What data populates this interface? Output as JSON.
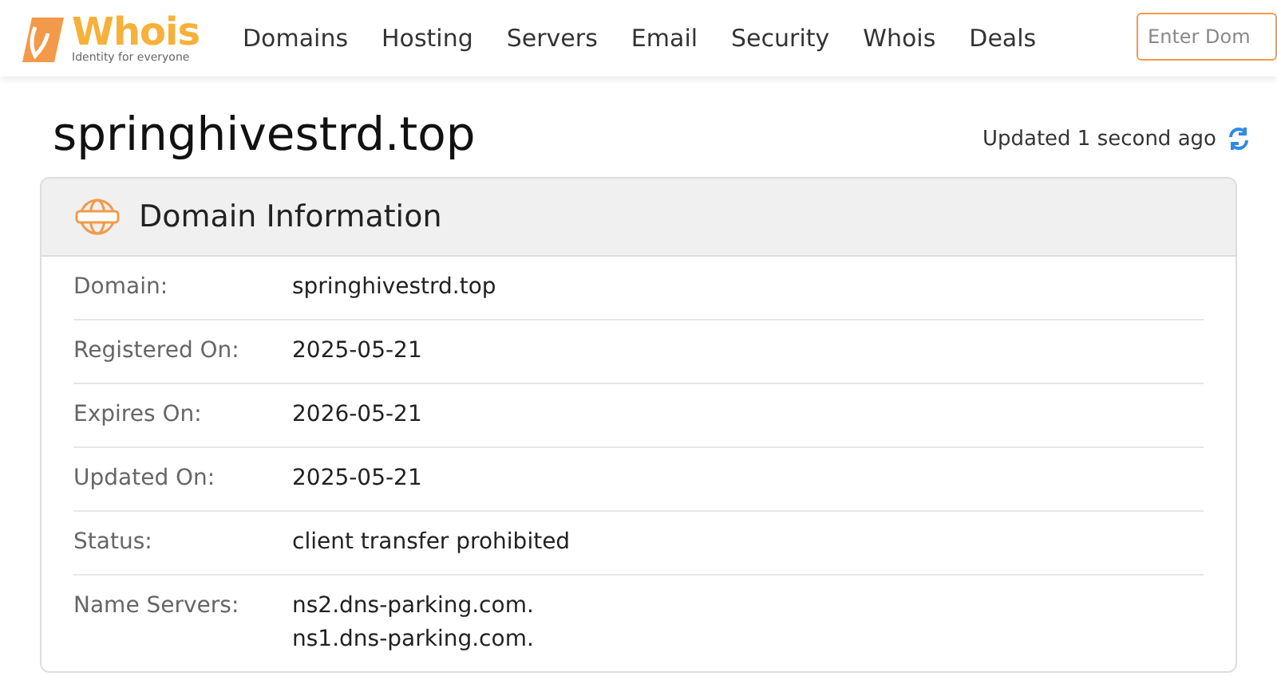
{
  "logo": {
    "name": "Whois",
    "tagline": "Identity for everyone"
  },
  "nav": [
    "Domains",
    "Hosting",
    "Servers",
    "Email",
    "Security",
    "Whois",
    "Deals"
  ],
  "search": {
    "placeholder": "Enter Dom"
  },
  "page_title": "springhivestrd.top",
  "updated": "Updated 1 second ago",
  "card": {
    "title": "Domain Information",
    "rows": [
      {
        "label": "Domain:",
        "values": [
          "springhivestrd.top"
        ]
      },
      {
        "label": "Registered On:",
        "values": [
          "2025-05-21"
        ]
      },
      {
        "label": "Expires On:",
        "values": [
          "2026-05-21"
        ]
      },
      {
        "label": "Updated On:",
        "values": [
          "2025-05-21"
        ]
      },
      {
        "label": "Status:",
        "values": [
          "client transfer prohibited"
        ]
      },
      {
        "label": "Name Servers:",
        "values": [
          "ns2.dns-parking.com.",
          "ns1.dns-parking.com."
        ]
      }
    ]
  }
}
